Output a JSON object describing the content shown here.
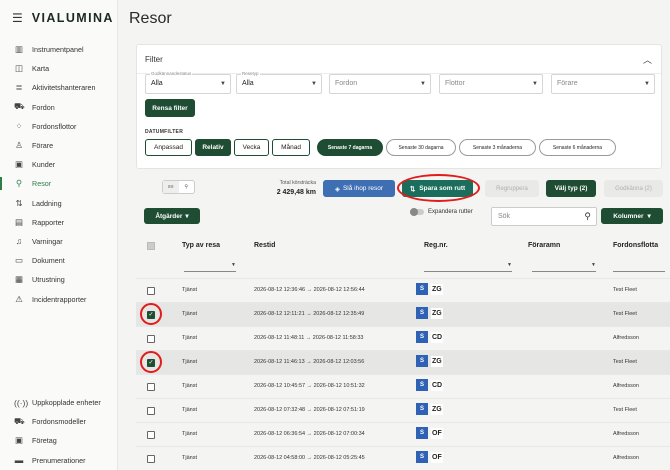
{
  "brand": {
    "name": "VIALUMINA",
    "menu_icon": "hamburger-icon"
  },
  "sidebar": {
    "items": [
      {
        "label": "Instrumentpanel",
        "icon": "chart-icon",
        "glyph": "▥"
      },
      {
        "label": "Karta",
        "icon": "map-icon",
        "glyph": "◫"
      },
      {
        "label": "Aktivitetshanteraren",
        "icon": "list-icon",
        "glyph": "≣"
      },
      {
        "label": "Fordon",
        "icon": "truck-icon",
        "glyph": "⛟"
      },
      {
        "label": "Fordonsflottor",
        "icon": "fleet-icon",
        "glyph": "⁘"
      },
      {
        "label": "Förare",
        "icon": "person-icon",
        "glyph": "♙"
      },
      {
        "label": "Kunder",
        "icon": "customer-icon",
        "glyph": "▣"
      },
      {
        "label": "Resor",
        "icon": "route-pin-icon",
        "glyph": "⚲"
      },
      {
        "label": "Laddning",
        "icon": "charging-icon",
        "glyph": "⇅"
      },
      {
        "label": "Rapporter",
        "icon": "report-icon",
        "glyph": "▤"
      },
      {
        "label": "Varningar",
        "icon": "bell-icon",
        "glyph": "♫"
      },
      {
        "label": "Dokument",
        "icon": "folder-icon",
        "glyph": "▭"
      },
      {
        "label": "Utrustning",
        "icon": "equipment-icon",
        "glyph": "▦"
      },
      {
        "label": "Incidentrapporter",
        "icon": "warning-icon",
        "glyph": "⚠"
      }
    ],
    "active_index": 7,
    "bottom_items": [
      {
        "label": "Uppkopplade enheter",
        "icon": "signal-icon",
        "glyph": "((·))"
      },
      {
        "label": "Fordonsmodeller",
        "icon": "car-model-icon",
        "glyph": "⛟"
      },
      {
        "label": "Företag",
        "icon": "building-icon",
        "glyph": "▣"
      },
      {
        "label": "Prenumerationer",
        "icon": "subscription-icon",
        "glyph": "▬"
      }
    ]
  },
  "page": {
    "title": "Resor"
  },
  "filter": {
    "heading": "Filter",
    "selects": [
      {
        "label": "Godkännandestatus",
        "value": "Alla"
      },
      {
        "label": "Resetyp",
        "value": "Alla"
      },
      {
        "label": "",
        "value": "Fordon"
      },
      {
        "label": "",
        "value": "Flottor"
      },
      {
        "label": "",
        "value": "Förare"
      }
    ],
    "clear_button": "Rensa filter",
    "date_filter_label": "DATUMFILTER",
    "modes": [
      "Anpassad",
      "Relativ",
      "Vecka",
      "Månad"
    ],
    "active_mode": "Relativ",
    "ranges": [
      "Senaste 7 dagarna",
      "Senaste 30 dagarna",
      "Senaste 3 månaderna",
      "Senaste 6 månaderna"
    ],
    "active_range": "Senaste 7 dagarna"
  },
  "toolbar": {
    "view_toggle": [
      "≡≡",
      "⚲"
    ],
    "total_distance_label": "Total körsträcka",
    "total_distance_value": "2 429,48 km",
    "merge_button": "Slå ihop resor",
    "save_route_button": "Spara som rutt",
    "regroup_button": "Regruppera",
    "choose_type_button": "Välj typ (2)",
    "approve_button": "Godkänna (2)",
    "actions_button": "Åtgärder",
    "expand_routes_label": "Expandera rutter",
    "search_placeholder": "Sök",
    "columns_button": "Kolumner"
  },
  "table": {
    "headers": [
      "Typ av resa",
      "Restid",
      "Reg.nr.",
      "Föraramn",
      "Fordonsflotta"
    ],
    "rows": [
      {
        "type": "Tjänst",
        "time": "2026-08-12 12:36:46 → 2026-08-12 12:56:44",
        "country": "S",
        "plate": "ZG",
        "driver": "",
        "fleet": "Test Fleet",
        "checked": false
      },
      {
        "type": "Tjänst",
        "time": "2026-08-12 12:11:21 → 2026-08-12 12:35:49",
        "country": "S",
        "plate": "ZG",
        "driver": "",
        "fleet": "Test Fleet",
        "checked": true
      },
      {
        "type": "Tjänst",
        "time": "2026-08-12 11:48:11 → 2026-08-12 11:58:33",
        "country": "S",
        "plate": "CD",
        "driver": "",
        "fleet": "Alfredsson",
        "checked": false
      },
      {
        "type": "Tjänst",
        "time": "2026-08-12 11:46:13 → 2026-08-12 12:03:56",
        "country": "S",
        "plate": "ZG",
        "driver": "",
        "fleet": "Test Fleet",
        "checked": true
      },
      {
        "type": "Tjänst",
        "time": "2026-08-12 10:45:57 → 2026-08-12 10:51:32",
        "country": "S",
        "plate": "CD",
        "driver": "",
        "fleet": "Alfredsson",
        "checked": false
      },
      {
        "type": "Tjänst",
        "time": "2026-08-12 07:32:48 → 2026-08-12 07:51:19",
        "country": "S",
        "plate": "ZG",
        "driver": "",
        "fleet": "Test Fleet",
        "checked": false
      },
      {
        "type": "Tjänst",
        "time": "2026-08-12 06:36:54 → 2026-08-12 07:00:34",
        "country": "S",
        "plate": "OF",
        "driver": "",
        "fleet": "Alfredsson",
        "checked": false
      },
      {
        "type": "Tjänst",
        "time": "2026-08-12 04:58:00 → 2026-08-12 05:25:45",
        "country": "S",
        "plate": "OF",
        "driver": "",
        "fleet": "Alfredsson",
        "checked": false
      }
    ]
  },
  "colors": {
    "primary": "#1e4d33",
    "teal": "#1c6e5c",
    "blue": "#3f6fb3",
    "annotation": "#e21b1b",
    "active_nav": "#2e7d4a"
  }
}
